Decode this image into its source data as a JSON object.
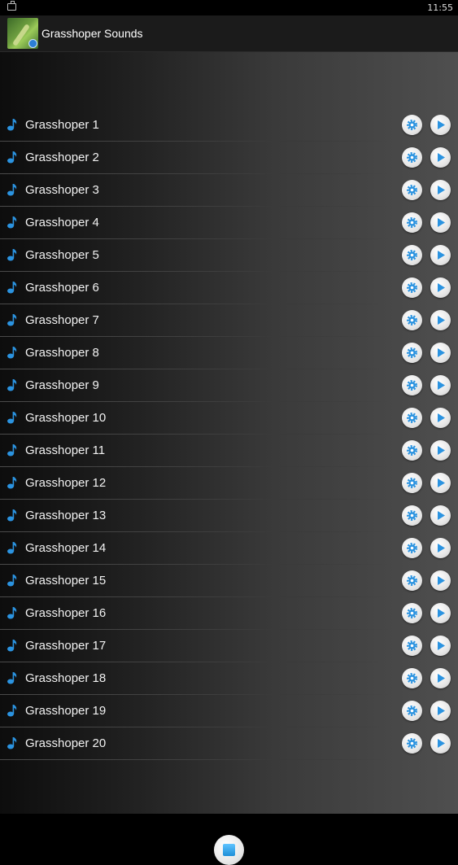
{
  "status_bar": {
    "time": "11:55"
  },
  "action_bar": {
    "title": "Grasshoper Sounds"
  },
  "colors": {
    "accent": "#2b93e0",
    "text": "#f2f2f2"
  },
  "icons": {
    "row_leading": "music-note-icon",
    "row_settings": "gear-icon",
    "row_play": "play-icon",
    "bottom": "stop-icon"
  },
  "sounds": [
    {
      "label": "Grasshoper 1"
    },
    {
      "label": "Grasshoper 2"
    },
    {
      "label": "Grasshoper 3"
    },
    {
      "label": "Grasshoper 4"
    },
    {
      "label": "Grasshoper 5"
    },
    {
      "label": "Grasshoper 6"
    },
    {
      "label": "Grasshoper 7"
    },
    {
      "label": "Grasshoper 8"
    },
    {
      "label": "Grasshoper 9"
    },
    {
      "label": "Grasshoper 10"
    },
    {
      "label": "Grasshoper 11"
    },
    {
      "label": "Grasshoper 12"
    },
    {
      "label": "Grasshoper 13"
    },
    {
      "label": "Grasshoper 14"
    },
    {
      "label": "Grasshoper 15"
    },
    {
      "label": "Grasshoper 16"
    },
    {
      "label": "Grasshoper 17"
    },
    {
      "label": "Grasshoper 18"
    },
    {
      "label": "Grasshoper 19"
    },
    {
      "label": "Grasshoper 20"
    }
  ]
}
